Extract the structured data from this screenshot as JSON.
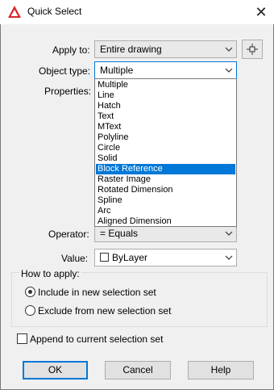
{
  "window": {
    "title": "Quick Select"
  },
  "apply_to": {
    "label": "Apply to:",
    "value": "Entire drawing"
  },
  "object_type": {
    "label": "Object type:",
    "value": "Multiple",
    "options": [
      "Multiple",
      "Line",
      "Hatch",
      "Text",
      "MText",
      "Polyline",
      "Circle",
      "Solid",
      "Block Reference",
      "Raster Image",
      "Rotated Dimension",
      "Spline",
      "Arc",
      "Aligned Dimension"
    ],
    "highlighted": "Block Reference"
  },
  "properties": {
    "label": "Properties:"
  },
  "operator": {
    "label": "Operator:",
    "value": "= Equals"
  },
  "value": {
    "label": "Value:",
    "value": "ByLayer"
  },
  "how_to_apply": {
    "label": "How to apply:",
    "include_label": "Include in new selection set",
    "exclude_label": "Exclude from new selection set",
    "selected": "include"
  },
  "append": {
    "label": "Append to current selection set",
    "checked": false
  },
  "buttons": {
    "ok": "OK",
    "cancel": "Cancel",
    "help": "Help"
  },
  "colors": {
    "accent": "#0078d7",
    "app_icon": "#d9262b"
  }
}
